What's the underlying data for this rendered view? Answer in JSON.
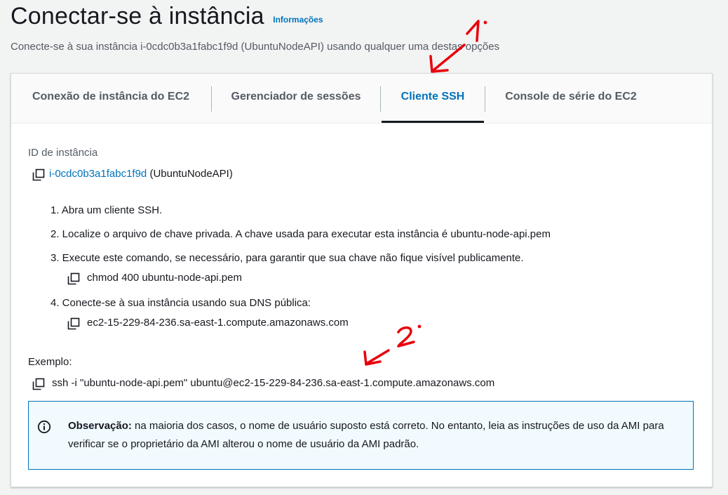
{
  "header": {
    "title": "Conectar-se à instância",
    "info_link": "Informações",
    "subtitle": "Conecte-se à sua instância i-0cdc0b3a1fabc1f9d (UbuntuNodeAPI) usando qualquer uma destas opções"
  },
  "tabs": [
    {
      "label": "Conexão de instância do EC2",
      "active": false
    },
    {
      "label": "Gerenciador de sessões",
      "active": false
    },
    {
      "label": "Cliente SSH",
      "active": true
    },
    {
      "label": "Console de série do EC2",
      "active": false
    }
  ],
  "instance": {
    "label": "ID de instância",
    "id": "i-0cdc0b3a1fabc1f9d",
    "name": "(UbuntuNodeAPI)"
  },
  "steps": [
    "1. Abra um cliente SSH.",
    "2. Localize o arquivo de chave privada. A chave usada para executar esta instância é ubuntu-node-api.pem",
    "3. Execute este comando, se necessário, para garantir que sua chave não fique visível publicamente.",
    "4. Conecte-se à sua instância usando sua DNS pública:"
  ],
  "chmod_command": "chmod 400 ubuntu-node-api.pem",
  "public_dns": "ec2-15-229-84-236.sa-east-1.compute.amazonaws.com",
  "example": {
    "label": "Exemplo:",
    "command": "ssh -i \"ubuntu-node-api.pem\" ubuntu@ec2-15-229-84-236.sa-east-1.compute.amazonaws.com"
  },
  "note": {
    "strong": "Observação:",
    "text": " na maioria dos casos, o nome de usuário suposto está correto. No entanto, leia as instruções de uso da AMI para verificar se o proprietário da AMI alterou o nome de usuário da AMI padrão."
  },
  "annotations": {
    "one": "1.",
    "two": "2."
  },
  "colors": {
    "link": "#0073bb",
    "annotation": "#e8000b",
    "note_bg": "#f1faff",
    "tab_active_underline": "#16191f"
  },
  "icons": [
    "copy-icon",
    "info-circle-icon"
  ]
}
